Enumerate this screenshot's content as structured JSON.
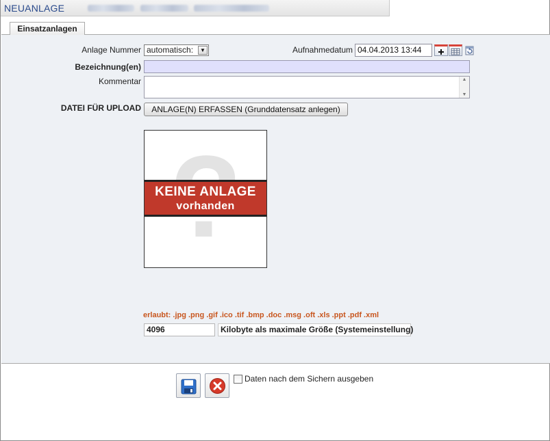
{
  "window": {
    "title": "NEUANLAGE"
  },
  "tabs": [
    {
      "label": "Einsatzanlagen",
      "active": true
    }
  ],
  "form": {
    "anlage_nummer": {
      "label": "Anlage Nummer",
      "selected": "automatisch:"
    },
    "aufnahmedatum": {
      "label": "Aufnahmedatum",
      "value": "04.04.2013 13:44"
    },
    "bezeichnung": {
      "label": "Bezeichnung(en)",
      "value": ""
    },
    "kommentar": {
      "label": "Kommentar",
      "value": ""
    },
    "upload": {
      "label": "DATEI FÜR UPLOAD",
      "button_label": "ANLAGE(N) ERFASSEN (Grunddatensatz anlegen)"
    },
    "placeholder": {
      "line1": "KEINE ANLAGE",
      "line2": "vorhanden"
    },
    "allowed_types": "erlaubt: .jpg .png .gif .ico .tif .bmp .doc .msg .oft .xls .ppt .pdf .xml",
    "max_size": {
      "value": "4096",
      "label": "Kilobyte als maximale Größe (Systemeinstellung)"
    }
  },
  "footer": {
    "save_icon": "floppy-disk-icon",
    "cancel_icon": "red-x-circle-icon",
    "checkbox_label": "Daten nach dem Sichern ausgeben",
    "checkbox_checked": false
  },
  "colors": {
    "title": "#2a4a8c",
    "panel_bg": "#eef1f5",
    "lavender_field": "#e0e0fc",
    "banner_red": "#c0392b",
    "allowed_text": "#c8561e"
  }
}
